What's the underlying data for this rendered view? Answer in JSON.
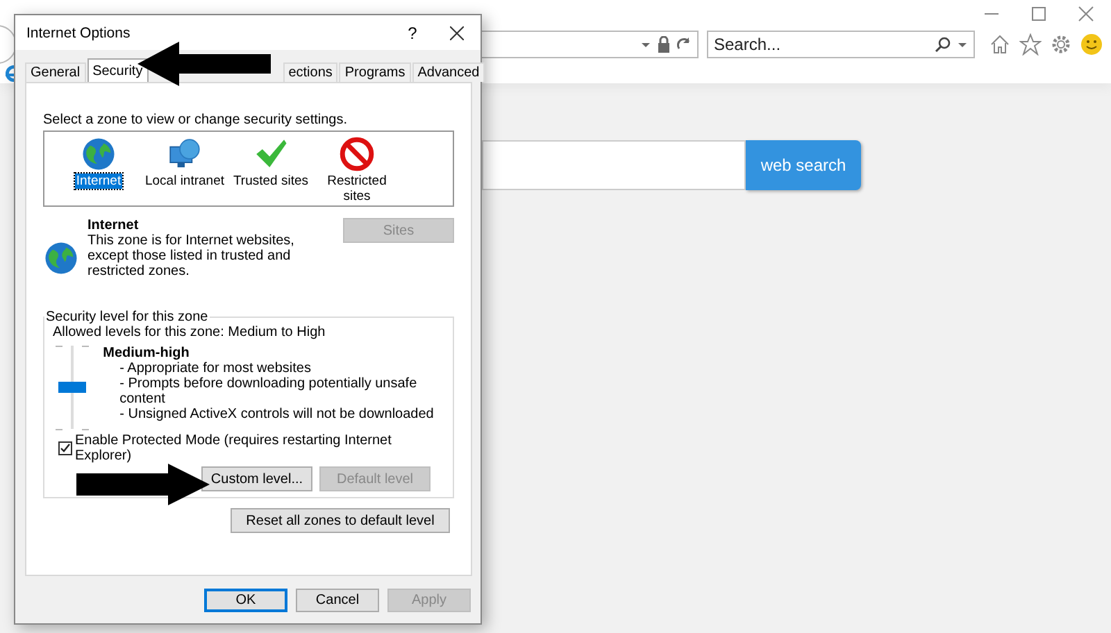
{
  "browser": {
    "search_field": {
      "placeholder": "Search..."
    },
    "page_search": {
      "button": "web search"
    }
  },
  "dialog": {
    "title": "Internet Options",
    "help": "?",
    "tabs": [
      {
        "label": "General",
        "selected": false
      },
      {
        "label": "Security",
        "selected": true
      },
      {
        "label": "ections",
        "selected": false
      },
      {
        "label": "Programs",
        "selected": false
      },
      {
        "label": "Advanced",
        "selected": false
      }
    ],
    "zone_prompt": "Select a zone to view or change security settings.",
    "zones": [
      {
        "label": "Internet",
        "kind": "globe",
        "selected": true
      },
      {
        "label": "Local intranet",
        "kind": "network",
        "selected": false
      },
      {
        "label": "Trusted sites",
        "kind": "check",
        "selected": false
      },
      {
        "label": "Restricted sites",
        "kind": "blocked",
        "selected": false
      }
    ],
    "zone_info": {
      "title": "Internet",
      "description": "This zone is for Internet websites, except those listed in trusted and restricted zones.",
      "sites_button": {
        "label": "Sites",
        "disabled": true
      }
    },
    "security_level": {
      "legend": "Security level for this zone",
      "allowed": "Allowed levels for this zone: Medium to High",
      "slider": {
        "level": 0.5
      },
      "level_name": "Medium-high",
      "bullets": [
        "- Appropriate for most websites",
        "- Prompts before downloading potentially unsafe content",
        "- Unsigned ActiveX controls will not be downloaded"
      ],
      "protected_mode": {
        "label": "Enable Protected Mode (requires restarting Internet Explorer)",
        "checked": true
      },
      "custom_button": {
        "label": "Custom level...",
        "disabled": false
      },
      "default_button": {
        "label": "Default level",
        "disabled": true
      }
    },
    "reset_button": {
      "label": "Reset all zones to default level",
      "disabled": false
    },
    "buttons": [
      {
        "label": "OK",
        "default": true,
        "disabled": false
      },
      {
        "label": "Cancel",
        "default": false,
        "disabled": false
      },
      {
        "label": "Apply",
        "default": false,
        "disabled": true
      }
    ]
  }
}
